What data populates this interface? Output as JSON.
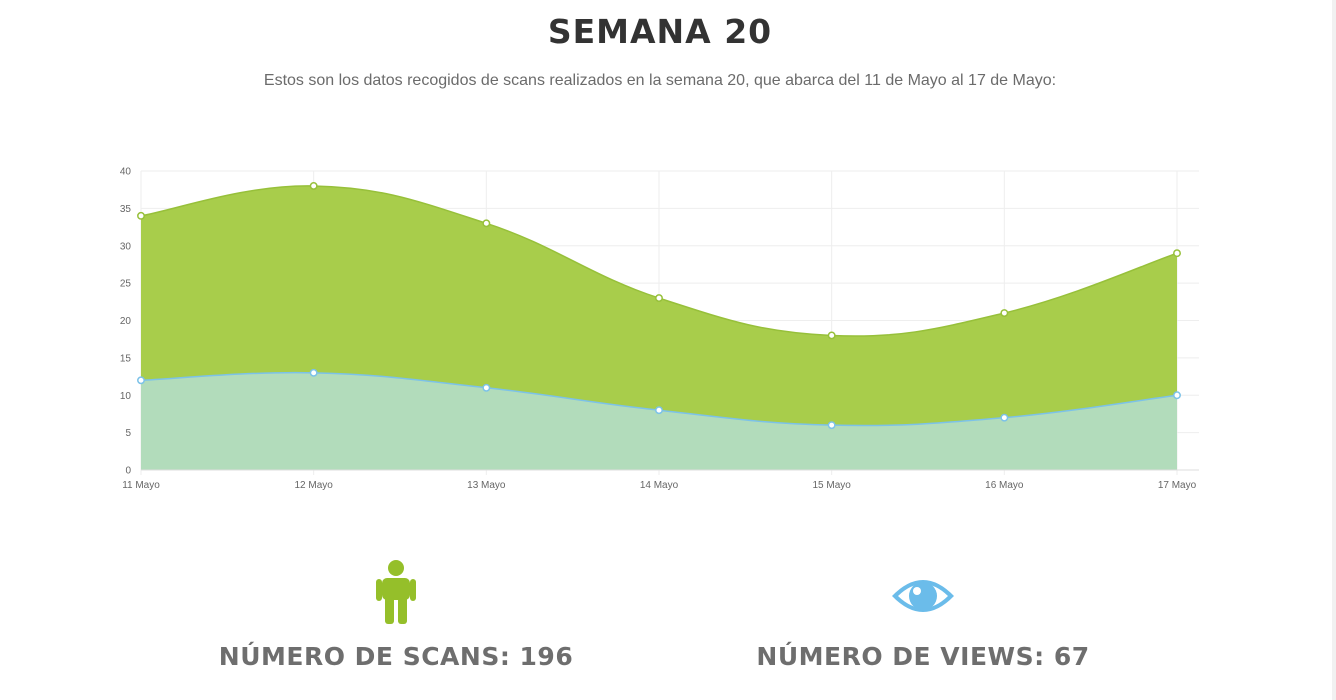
{
  "header": {
    "title": "SEMANA 20",
    "subtitle": "Estos son los datos recogidos de scans realizados en la semana 20, que abarca del 11 de Mayo al 17 de Mayo:"
  },
  "chart_data": {
    "type": "area",
    "stacked": true,
    "title": "",
    "xlabel": "",
    "ylabel": "",
    "categories": [
      "11 Mayo",
      "12 Mayo",
      "13 Mayo",
      "14 Mayo",
      "15 Mayo",
      "16 Mayo",
      "17 Mayo"
    ],
    "series": [
      {
        "key": "scans",
        "color": "#a8cd4b",
        "stroke": "#97c03a",
        "values": [
          22,
          25,
          22,
          15,
          12,
          14,
          19
        ]
      },
      {
        "key": "views",
        "color": "#b2dcbb",
        "stroke": "#7cc2e8",
        "values": [
          12,
          13,
          11,
          8,
          6,
          7,
          10
        ]
      }
    ],
    "ylim": [
      0,
      40
    ],
    "yticks": [
      0,
      5,
      10,
      15,
      20,
      25,
      30,
      35,
      40
    ],
    "grid": true,
    "legend": "none"
  },
  "stats": {
    "scans": {
      "label": "NÚMERO DE SCANS: 196",
      "icon": "person-icon",
      "color": "#95bf2a"
    },
    "views": {
      "label": "NÚMERO DE VIEWS: 67",
      "icon": "eye-icon",
      "color": "#6bbcea"
    }
  }
}
